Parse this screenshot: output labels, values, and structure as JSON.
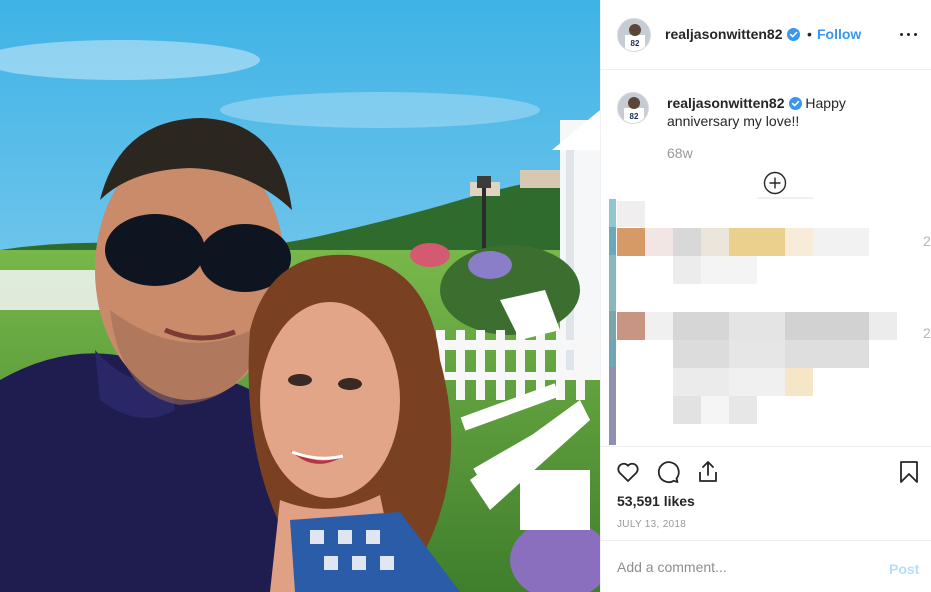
{
  "post": {
    "username": "realjasonwitten82",
    "verified_icon": "verified-badge-icon",
    "dot": "•",
    "follow_label": "Follow",
    "more_icon": "more-options-icon",
    "caption_text": "Happy anniversary my love!!",
    "age": "68w",
    "load_more_icon": "plus-circle-icon",
    "partial_char": "2",
    "likes": "53,591 likes",
    "date": "JULY 13, 2018",
    "comment_placeholder": "Add a comment...",
    "post_label": "Post"
  },
  "colors": {
    "link": "#3897f0",
    "post_disabled": "#b2dffc",
    "text": "#262626",
    "muted": "#999999",
    "border": "#efefef"
  },
  "icons": [
    "heart-icon",
    "comment-icon",
    "share-icon",
    "bookmark-icon"
  ]
}
